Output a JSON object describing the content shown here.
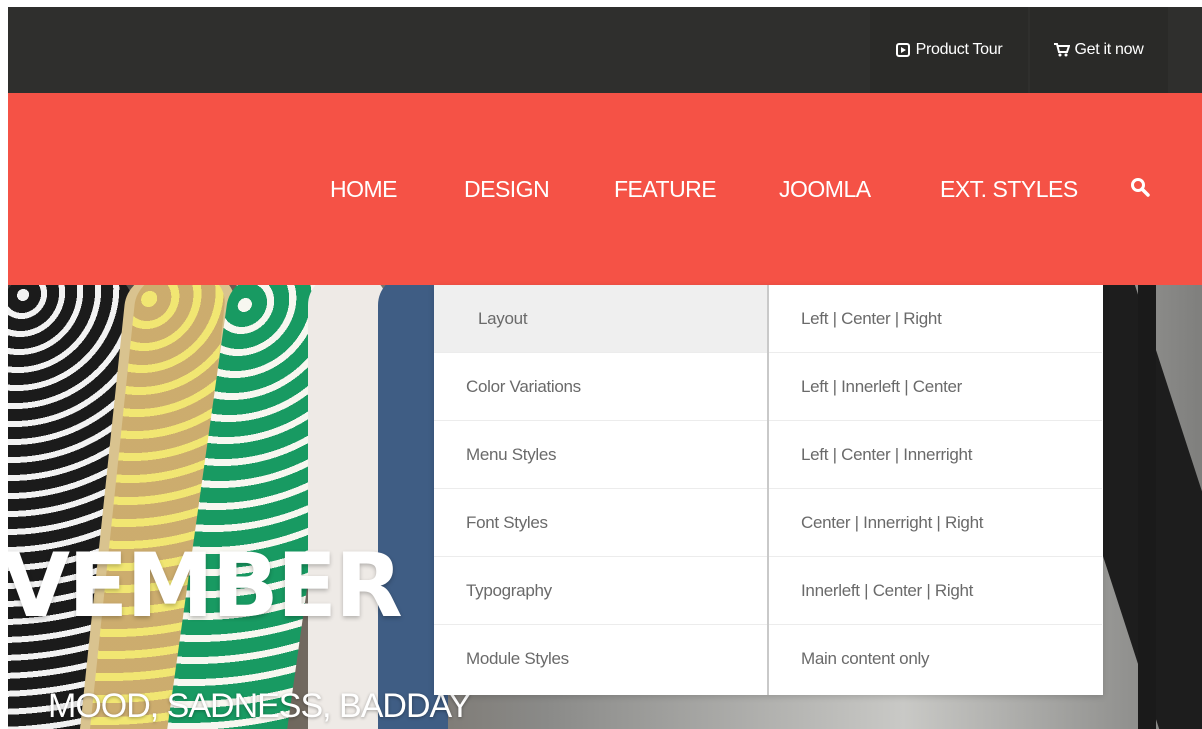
{
  "topbar": {
    "product_tour": "Product Tour",
    "get_it_now": "Get it now"
  },
  "nav": {
    "items": [
      "HOME",
      "DESIGN",
      "FEATURE",
      "JOOMLA",
      "EXT. STYLES"
    ],
    "search_icon": "search-icon"
  },
  "hero": {
    "title": "VEMBER",
    "subtitle": "MOOD, SADNESS, BADDAY"
  },
  "dropdown": {
    "left": [
      "Layout",
      "Color Variations",
      "Menu Styles",
      "Font Styles",
      "Typography",
      "Module Styles"
    ],
    "right": [
      "Left | Center | Right",
      "Left | Innerleft | Center",
      "Left | Center | Innerright",
      "Center | Innerright | Right",
      "Innerleft | Center | Right",
      "Main content only"
    ],
    "active_left": "Layout"
  },
  "colors": {
    "topbar": "#2f2f2d",
    "nav": "#f55246",
    "dropdown_text": "#6a6a6a",
    "active_bg": "#efefef"
  }
}
